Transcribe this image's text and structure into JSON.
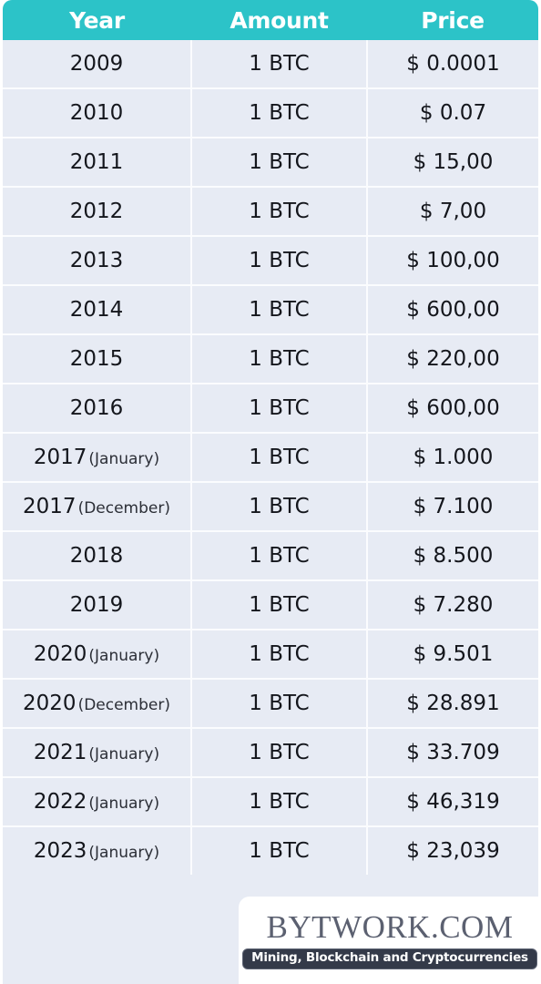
{
  "table": {
    "columns": [
      "Year",
      "Amount",
      "Price"
    ],
    "rows": [
      {
        "year": "2009",
        "year_note": "",
        "amount": "1 BTC",
        "price": "$ 0.0001"
      },
      {
        "year": "2010",
        "year_note": "",
        "amount": "1 BTC",
        "price": "$ 0.07"
      },
      {
        "year": "2011",
        "year_note": "",
        "amount": "1 BTC",
        "price": "$ 15,00"
      },
      {
        "year": "2012",
        "year_note": "",
        "amount": "1 BTC",
        "price": "$ 7,00"
      },
      {
        "year": "2013",
        "year_note": "",
        "amount": "1 BTC",
        "price": "$ 100,00"
      },
      {
        "year": "2014",
        "year_note": "",
        "amount": "1 BTC",
        "price": "$ 600,00"
      },
      {
        "year": "2015",
        "year_note": "",
        "amount": "1 BTC",
        "price": "$ 220,00"
      },
      {
        "year": "2016",
        "year_note": "",
        "amount": "1 BTC",
        "price": "$ 600,00"
      },
      {
        "year": "2017",
        "year_note": "(January)",
        "amount": "1 BTC",
        "price": "$ 1.000"
      },
      {
        "year": "2017",
        "year_note": "(December)",
        "amount": "1 BTC",
        "price": "$ 7.100"
      },
      {
        "year": "2018",
        "year_note": "",
        "amount": "1 BTC",
        "price": "$ 8.500"
      },
      {
        "year": "2019",
        "year_note": "",
        "amount": "1 BTC",
        "price": "$ 7.280"
      },
      {
        "year": "2020",
        "year_note": "(January)",
        "amount": "1 BTC",
        "price": "$ 9.501"
      },
      {
        "year": "2020",
        "year_note": "(December)",
        "amount": "1 BTC",
        "price": "$ 28.891"
      },
      {
        "year": "2021",
        "year_note": "(January)",
        "amount": "1 BTC",
        "price": "$ 33.709"
      },
      {
        "year": "2022",
        "year_note": "(January)",
        "amount": "1 BTC",
        "price": "$ 46,319"
      },
      {
        "year": "2023",
        "year_note": "(January)",
        "amount": "1 BTC",
        "price": "$ 23,039"
      }
    ]
  },
  "logo": {
    "wordmark": "BYTWORK.COM",
    "tagline": "Mining, Blockchain and Cryptocurrencies"
  },
  "colors": {
    "header_teal": "#2cc3c8",
    "row_background": "#e7ebf4",
    "row_divider": "#fbfcfe",
    "text": "#14161c",
    "logo_text": "#5b6070",
    "tagline_badge": "#343a49"
  }
}
